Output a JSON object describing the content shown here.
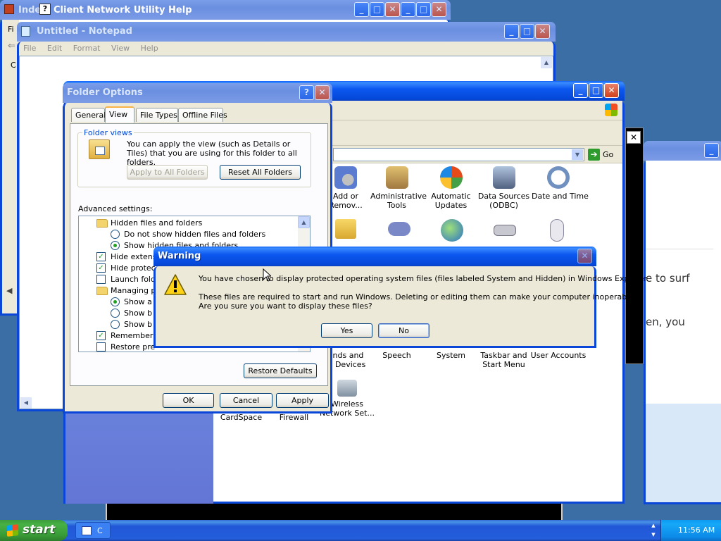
{
  "windows": {
    "help": {
      "title_short": "Inde",
      "title": "Client Network Utility Help",
      "side_letters": [
        "Fi",
        "C"
      ]
    },
    "notepad": {
      "title": "Untitled - Notepad",
      "menu": [
        "File",
        "Edit",
        "Format",
        "View",
        "Help"
      ]
    },
    "control_panel": {
      "go_label": "Go",
      "row1": [
        {
          "label": "Add or\nRemov..."
        },
        {
          "label": "Administrative\nTools"
        },
        {
          "label": "Automatic\nUpdates"
        },
        {
          "label": "Data Sources\n(ODBC)"
        },
        {
          "label": "Date and Time"
        }
      ],
      "row3": [
        {
          "label": "unds and\nio Devices"
        },
        {
          "label": "Speech"
        },
        {
          "label": "System"
        },
        {
          "label": "Taskbar and\nStart Menu"
        },
        {
          "label": "User Accounts"
        }
      ],
      "row4": [
        {
          "label": "CardSpace"
        },
        {
          "label": "Firewall"
        },
        {
          "label": "Wireless\nNetwork Set..."
        }
      ]
    },
    "browser": {
      "text1": "e to surf",
      "text2": "en, you"
    }
  },
  "folder_options": {
    "title": "Folder Options",
    "tabs": [
      "General",
      "View",
      "File Types",
      "Offline Files"
    ],
    "folder_views_legend": "Folder views",
    "folder_views_text": "You can apply the view (such as Details or Tiles) that you are using for this folder to all folders.",
    "apply_all_label": "Apply to All Folders",
    "reset_all_label": "Reset All Folders",
    "advanced_label": "Advanced settings:",
    "tree": [
      {
        "type": "folder",
        "text": "Hidden files and folders"
      },
      {
        "type": "radio",
        "checked": false,
        "text": "Do not show hidden files and folders"
      },
      {
        "type": "radio",
        "checked": true,
        "text": "Show hidden files and folders"
      },
      {
        "type": "check",
        "checked": true,
        "text": "Hide extens"
      },
      {
        "type": "check",
        "checked": true,
        "text": "Hide protec"
      },
      {
        "type": "check",
        "checked": false,
        "text": "Launch fold"
      },
      {
        "type": "folder",
        "text": "Managing p"
      },
      {
        "type": "radio",
        "checked": true,
        "text": "Show a"
      },
      {
        "type": "radio",
        "checked": false,
        "text": "Show b"
      },
      {
        "type": "radio",
        "checked": false,
        "text": "Show b"
      },
      {
        "type": "check",
        "checked": true,
        "text": "Remember e"
      },
      {
        "type": "check",
        "checked": false,
        "text": "Restore pre"
      }
    ],
    "restore_defaults_label": "Restore Defaults",
    "ok_label": "OK",
    "cancel_label": "Cancel",
    "apply_label": "Apply"
  },
  "warning": {
    "title": "Warning",
    "line1": "You have chosen to display protected operating system files (files labeled System and Hidden) in Windows Explorer.",
    "line2": "These files are required to start and run Windows. Deleting or editing them can make your computer inoperable.",
    "line3": "Are you sure you want to display these files?",
    "yes_label": "Yes",
    "no_label": "No"
  },
  "taskbar": {
    "start_label": "start",
    "task_label": "C",
    "clock": "11:56 AM"
  },
  "colors": {
    "xp_blue": "#0a46d8",
    "desktop": "#3a6ea5",
    "start_green": "#3c9a3a"
  }
}
